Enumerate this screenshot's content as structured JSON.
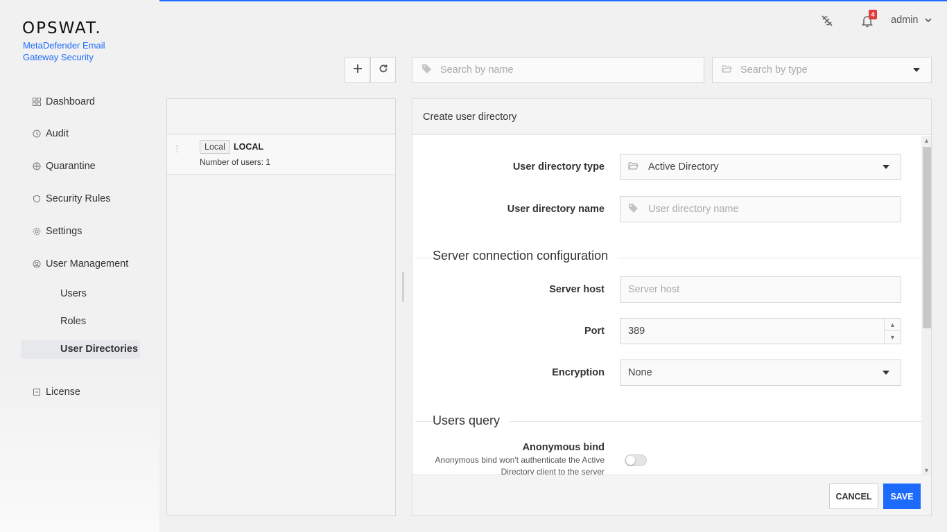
{
  "brand": {
    "logo": "OPSWAT.",
    "product": "MetaDefender Email Gateway Security"
  },
  "header": {
    "notification_count": "4",
    "user": "admin"
  },
  "sidebar": {
    "items": [
      {
        "label": "Dashboard",
        "icon": "grid-icon"
      },
      {
        "label": "Audit",
        "icon": "audit-icon"
      },
      {
        "label": "Quarantine",
        "icon": "globe-icon"
      },
      {
        "label": "Security Rules",
        "icon": "shield-icon"
      },
      {
        "label": "Settings",
        "icon": "gear-icon"
      },
      {
        "label": "User Management",
        "icon": "user-circle-icon"
      }
    ],
    "sub_items": [
      "Users",
      "Roles",
      "User Directories"
    ],
    "active_sub": "User Directories",
    "license": "License"
  },
  "toolbar": {
    "search_name_placeholder": "Search by name",
    "search_type_placeholder": "Search by type"
  },
  "list": {
    "rows": [
      {
        "tag": "Local",
        "title": "LOCAL",
        "subtitle": "Number of users: 1"
      }
    ]
  },
  "form": {
    "title": "Create user directory",
    "type_label": "User directory type",
    "type_value": "Active Directory",
    "name_label": "User directory name",
    "name_placeholder": "User directory name",
    "section_server": "Server connection configuration",
    "host_label": "Server host",
    "host_placeholder": "Server host",
    "port_label": "Port",
    "port_value": "389",
    "encryption_label": "Encryption",
    "encryption_value": "None",
    "section_users": "Users query",
    "anon_label": "Anonymous bind",
    "anon_help": "Anonymous bind won't authenticate the Active Directory client to the server",
    "anon_enabled": false,
    "cancel": "CANCEL",
    "save": "SAVE"
  },
  "colors": {
    "accent": "#1d6bfc",
    "badge": "#e03c3c"
  }
}
